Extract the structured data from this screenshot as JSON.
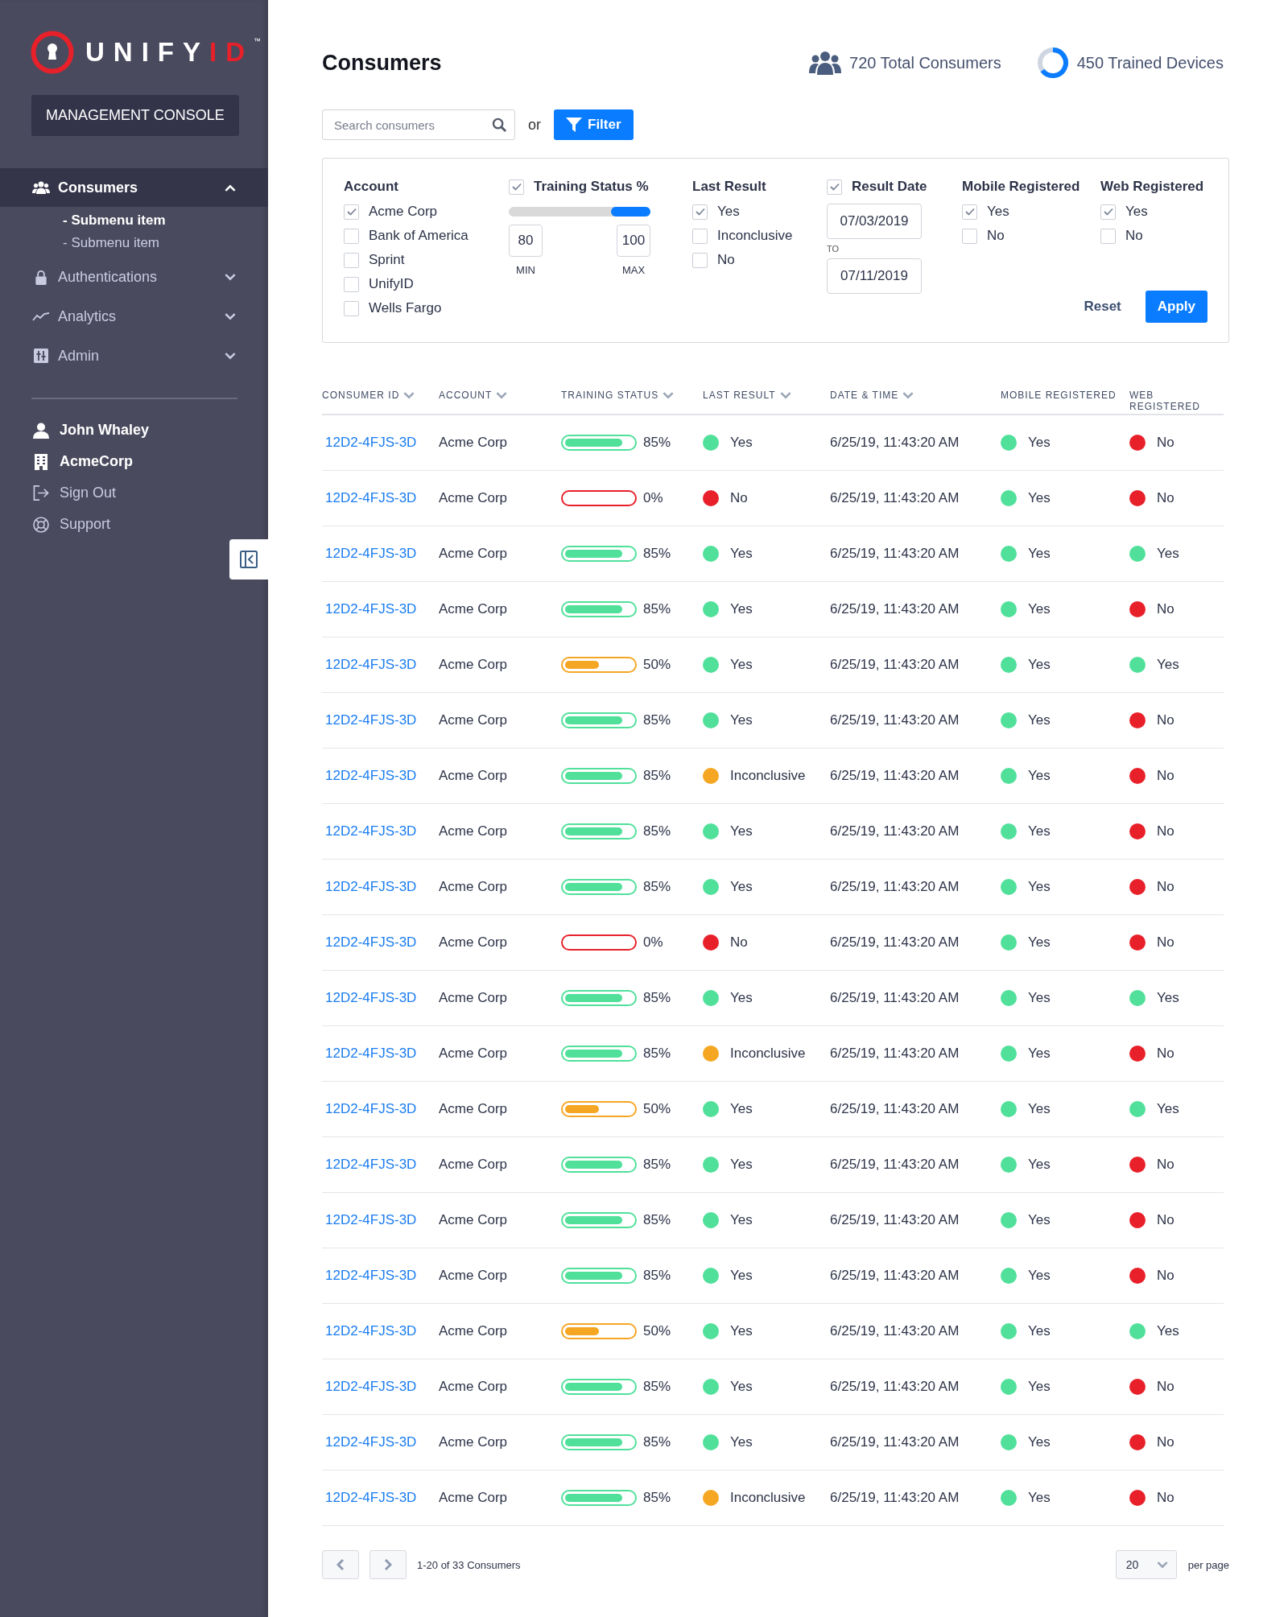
{
  "sidebar": {
    "logo": {
      "text": "UNIFY",
      "accent": "ID",
      "mark": "™"
    },
    "console_button": "MANAGEMENT CONSOLE",
    "nav": [
      {
        "label": "Consumers",
        "expanded": true,
        "selected": true,
        "children": [
          {
            "label": "- Submenu item",
            "selected": true
          },
          {
            "label": "- Submenu item",
            "selected": false
          }
        ]
      },
      {
        "label": "Authentications",
        "expanded": false,
        "selected": false
      },
      {
        "label": "Analytics",
        "expanded": false,
        "selected": false
      },
      {
        "label": "Admin",
        "expanded": false,
        "selected": false
      }
    ],
    "account": [
      {
        "label": "John Whaley",
        "kind": "user"
      },
      {
        "label": "AcmeCorp",
        "kind": "org"
      },
      {
        "label": "Sign Out",
        "kind": "signout"
      },
      {
        "label": "Support",
        "kind": "support"
      }
    ]
  },
  "header": {
    "title": "Consumers",
    "stats": [
      "720 Total Consumers",
      "450 Trained Devices"
    ]
  },
  "search": {
    "placeholder": "Search consumers",
    "or": "or",
    "filter_button": "Filter"
  },
  "filters": [
    {
      "kind": "checklist",
      "title": "Account",
      "options": [
        {
          "label": "Acme Corp",
          "checked": true
        },
        {
          "label": "Bank of America",
          "checked": false
        },
        {
          "label": "Sprint",
          "checked": false
        },
        {
          "label": "UnifyID",
          "checked": false
        },
        {
          "label": "Wells Fargo",
          "checked": false
        }
      ]
    },
    {
      "kind": "range",
      "title": "Training Status %",
      "checked": true,
      "min": "80",
      "max": "100",
      "min_label": "MIN",
      "max_label": "MAX"
    },
    {
      "kind": "checklist",
      "title": "Last Result",
      "options": [
        {
          "label": "Yes",
          "checked": true
        },
        {
          "label": "Inconclusive",
          "checked": false
        },
        {
          "label": "No",
          "checked": false
        }
      ]
    },
    {
      "kind": "date_range",
      "title": "Result Date",
      "checked": true,
      "from": "07/03/2019",
      "to_label": "TO",
      "to": "07/11/2019"
    },
    {
      "kind": "checklist",
      "title": "Mobile Registered",
      "options": [
        {
          "label": "Yes",
          "checked": true
        },
        {
          "label": "No",
          "checked": false
        }
      ]
    },
    {
      "kind": "checklist",
      "title": "Web Registered",
      "options": [
        {
          "label": "Yes",
          "checked": true
        },
        {
          "label": "No",
          "checked": false
        }
      ]
    }
  ],
  "filter_actions": {
    "reset": "Reset",
    "apply": "Apply"
  },
  "table": {
    "columns": [
      {
        "label": "CONSUMER ID",
        "sortable": true
      },
      {
        "label": "ACCOUNT",
        "sortable": true
      },
      {
        "label": "TRAINING STATUS",
        "sortable": true
      },
      {
        "label": "LAST RESULT",
        "sortable": true
      },
      {
        "label": "DATE & TIME",
        "sortable": true
      },
      {
        "label": "MOBILE REGISTERED",
        "sortable": false
      },
      {
        "label": "WEB REGISTERED",
        "sortable": false
      }
    ],
    "rows": [
      {
        "id": "12D2-4FJS-3D",
        "account": "Acme Corp",
        "training": {
          "level": 0.85,
          "reading": "85%",
          "color": "#50e09a"
        },
        "last_result": {
          "text": "Yes",
          "color": "#50e09a"
        },
        "date_time": "6/25/19, 11:43:20 AM",
        "mobile": {
          "text": "Yes",
          "color": "#50e09a"
        },
        "web": {
          "text": "No",
          "color": "#e8202a"
        }
      },
      {
        "id": "12D2-4FJS-3D",
        "account": "Acme Corp",
        "training": {
          "level": 0,
          "reading": "0%",
          "color": "#e8202a"
        },
        "last_result": {
          "text": "No",
          "color": "#e8202a"
        },
        "date_time": "6/25/19, 11:43:20 AM",
        "mobile": {
          "text": "Yes",
          "color": "#50e09a"
        },
        "web": {
          "text": "No",
          "color": "#e8202a"
        }
      },
      {
        "id": "12D2-4FJS-3D",
        "account": "Acme Corp",
        "training": {
          "level": 0.85,
          "reading": "85%",
          "color": "#50e09a"
        },
        "last_result": {
          "text": "Yes",
          "color": "#50e09a"
        },
        "date_time": "6/25/19, 11:43:20 AM",
        "mobile": {
          "text": "Yes",
          "color": "#50e09a"
        },
        "web": {
          "text": "Yes",
          "color": "#50e09a"
        }
      },
      {
        "id": "12D2-4FJS-3D",
        "account": "Acme Corp",
        "training": {
          "level": 0.85,
          "reading": "85%",
          "color": "#50e09a"
        },
        "last_result": {
          "text": "Yes",
          "color": "#50e09a"
        },
        "date_time": "6/25/19, 11:43:20 AM",
        "mobile": {
          "text": "Yes",
          "color": "#50e09a"
        },
        "web": {
          "text": "No",
          "color": "#e8202a"
        }
      },
      {
        "id": "12D2-4FJS-3D",
        "account": "Acme Corp",
        "training": {
          "level": 0.5,
          "reading": "50%",
          "color": "#f5a623"
        },
        "last_result": {
          "text": "Yes",
          "color": "#50e09a"
        },
        "date_time": "6/25/19, 11:43:20 AM",
        "mobile": {
          "text": "Yes",
          "color": "#50e09a"
        },
        "web": {
          "text": "Yes",
          "color": "#50e09a"
        }
      },
      {
        "id": "12D2-4FJS-3D",
        "account": "Acme Corp",
        "training": {
          "level": 0.85,
          "reading": "85%",
          "color": "#50e09a"
        },
        "last_result": {
          "text": "Yes",
          "color": "#50e09a"
        },
        "date_time": "6/25/19, 11:43:20 AM",
        "mobile": {
          "text": "Yes",
          "color": "#50e09a"
        },
        "web": {
          "text": "No",
          "color": "#e8202a"
        }
      },
      {
        "id": "12D2-4FJS-3D",
        "account": "Acme Corp",
        "training": {
          "level": 0.85,
          "reading": "85%",
          "color": "#50e09a"
        },
        "last_result": {
          "text": "Inconclusive",
          "color": "#f5a623"
        },
        "date_time": "6/25/19, 11:43:20 AM",
        "mobile": {
          "text": "Yes",
          "color": "#50e09a"
        },
        "web": {
          "text": "No",
          "color": "#e8202a"
        }
      },
      {
        "id": "12D2-4FJS-3D",
        "account": "Acme Corp",
        "training": {
          "level": 0.85,
          "reading": "85%",
          "color": "#50e09a"
        },
        "last_result": {
          "text": "Yes",
          "color": "#50e09a"
        },
        "date_time": "6/25/19, 11:43:20 AM",
        "mobile": {
          "text": "Yes",
          "color": "#50e09a"
        },
        "web": {
          "text": "No",
          "color": "#e8202a"
        }
      },
      {
        "id": "12D2-4FJS-3D",
        "account": "Acme Corp",
        "training": {
          "level": 0.85,
          "reading": "85%",
          "color": "#50e09a"
        },
        "last_result": {
          "text": "Yes",
          "color": "#50e09a"
        },
        "date_time": "6/25/19, 11:43:20 AM",
        "mobile": {
          "text": "Yes",
          "color": "#50e09a"
        },
        "web": {
          "text": "No",
          "color": "#e8202a"
        }
      },
      {
        "id": "12D2-4FJS-3D",
        "account": "Acme Corp",
        "training": {
          "level": 0,
          "reading": "0%",
          "color": "#e8202a"
        },
        "last_result": {
          "text": "No",
          "color": "#e8202a"
        },
        "date_time": "6/25/19, 11:43:20 AM",
        "mobile": {
          "text": "Yes",
          "color": "#50e09a"
        },
        "web": {
          "text": "No",
          "color": "#e8202a"
        }
      },
      {
        "id": "12D2-4FJS-3D",
        "account": "Acme Corp",
        "training": {
          "level": 0.85,
          "reading": "85%",
          "color": "#50e09a"
        },
        "last_result": {
          "text": "Yes",
          "color": "#50e09a"
        },
        "date_time": "6/25/19, 11:43:20 AM",
        "mobile": {
          "text": "Yes",
          "color": "#50e09a"
        },
        "web": {
          "text": "Yes",
          "color": "#50e09a"
        }
      },
      {
        "id": "12D2-4FJS-3D",
        "account": "Acme Corp",
        "training": {
          "level": 0.85,
          "reading": "85%",
          "color": "#50e09a"
        },
        "last_result": {
          "text": "Inconclusive",
          "color": "#f5a623"
        },
        "date_time": "6/25/19, 11:43:20 AM",
        "mobile": {
          "text": "Yes",
          "color": "#50e09a"
        },
        "web": {
          "text": "No",
          "color": "#e8202a"
        }
      },
      {
        "id": "12D2-4FJS-3D",
        "account": "Acme Corp",
        "training": {
          "level": 0.5,
          "reading": "50%",
          "color": "#f5a623"
        },
        "last_result": {
          "text": "Yes",
          "color": "#50e09a"
        },
        "date_time": "6/25/19, 11:43:20 AM",
        "mobile": {
          "text": "Yes",
          "color": "#50e09a"
        },
        "web": {
          "text": "Yes",
          "color": "#50e09a"
        }
      },
      {
        "id": "12D2-4FJS-3D",
        "account": "Acme Corp",
        "training": {
          "level": 0.85,
          "reading": "85%",
          "color": "#50e09a"
        },
        "last_result": {
          "text": "Yes",
          "color": "#50e09a"
        },
        "date_time": "6/25/19, 11:43:20 AM",
        "mobile": {
          "text": "Yes",
          "color": "#50e09a"
        },
        "web": {
          "text": "No",
          "color": "#e8202a"
        }
      },
      {
        "id": "12D2-4FJS-3D",
        "account": "Acme Corp",
        "training": {
          "level": 0.85,
          "reading": "85%",
          "color": "#50e09a"
        },
        "last_result": {
          "text": "Yes",
          "color": "#50e09a"
        },
        "date_time": "6/25/19, 11:43:20 AM",
        "mobile": {
          "text": "Yes",
          "color": "#50e09a"
        },
        "web": {
          "text": "No",
          "color": "#e8202a"
        }
      },
      {
        "id": "12D2-4FJS-3D",
        "account": "Acme Corp",
        "training": {
          "level": 0.85,
          "reading": "85%",
          "color": "#50e09a"
        },
        "last_result": {
          "text": "Yes",
          "color": "#50e09a"
        },
        "date_time": "6/25/19, 11:43:20 AM",
        "mobile": {
          "text": "Yes",
          "color": "#50e09a"
        },
        "web": {
          "text": "No",
          "color": "#e8202a"
        }
      },
      {
        "id": "12D2-4FJS-3D",
        "account": "Acme Corp",
        "training": {
          "level": 0.5,
          "reading": "50%",
          "color": "#f5a623"
        },
        "last_result": {
          "text": "Yes",
          "color": "#50e09a"
        },
        "date_time": "6/25/19, 11:43:20 AM",
        "mobile": {
          "text": "Yes",
          "color": "#50e09a"
        },
        "web": {
          "text": "Yes",
          "color": "#50e09a"
        }
      },
      {
        "id": "12D2-4FJS-3D",
        "account": "Acme Corp",
        "training": {
          "level": 0.85,
          "reading": "85%",
          "color": "#50e09a"
        },
        "last_result": {
          "text": "Yes",
          "color": "#50e09a"
        },
        "date_time": "6/25/19, 11:43:20 AM",
        "mobile": {
          "text": "Yes",
          "color": "#50e09a"
        },
        "web": {
          "text": "No",
          "color": "#e8202a"
        }
      },
      {
        "id": "12D2-4FJS-3D",
        "account": "Acme Corp",
        "training": {
          "level": 0.85,
          "reading": "85%",
          "color": "#50e09a"
        },
        "last_result": {
          "text": "Yes",
          "color": "#50e09a"
        },
        "date_time": "6/25/19, 11:43:20 AM",
        "mobile": {
          "text": "Yes",
          "color": "#50e09a"
        },
        "web": {
          "text": "No",
          "color": "#e8202a"
        }
      },
      {
        "id": "12D2-4FJS-3D",
        "account": "Acme Corp",
        "training": {
          "level": 0.85,
          "reading": "85%",
          "color": "#50e09a"
        },
        "last_result": {
          "text": "Inconclusive",
          "color": "#f5a623"
        },
        "date_time": "6/25/19, 11:43:20 AM",
        "mobile": {
          "text": "Yes",
          "color": "#50e09a"
        },
        "web": {
          "text": "No",
          "color": "#e8202a"
        }
      }
    ]
  },
  "pagination": {
    "summary": "1-20 of 33 Consumers",
    "per_page_value": "20",
    "per_page_label": "per page"
  }
}
